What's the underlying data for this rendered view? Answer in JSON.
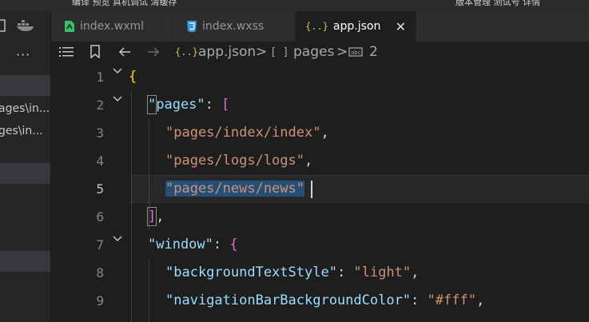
{
  "topbar": {
    "menu_text": "编译   预览   真机调试   清缓存",
    "right_text": "版本管理   测试号   详情"
  },
  "sidebar": {
    "more_label": "···",
    "items": [
      "ages\\in...",
      "ges\\in..."
    ]
  },
  "tabs": [
    {
      "label": "index.wxml",
      "icon": "wxml-file-icon",
      "color": "#3dbb6d"
    },
    {
      "label": "index.wxss",
      "icon": "css-file-icon",
      "color": "#3a96dd"
    },
    {
      "label": "app.json",
      "icon": "json-file-icon",
      "color": "#d7ba5d",
      "active": true,
      "close": "✕"
    }
  ],
  "breadcrumb": {
    "file": "app.json",
    "sep1": ">",
    "pages_label": "pages",
    "sep2": ">",
    "index_label": "2"
  },
  "editor": {
    "current_line": 5,
    "lines": [
      {
        "n": "1",
        "p1": "{"
      },
      {
        "n": "2",
        "key": "\"pages\"",
        "colon": ": ",
        "bracket": "["
      },
      {
        "n": "3",
        "str": "\"pages/index/index\"",
        "comma": ","
      },
      {
        "n": "4",
        "str": "\"pages/logs/logs\"",
        "comma": ","
      },
      {
        "n": "5",
        "str": "\"pages/news/news\""
      },
      {
        "n": "6",
        "bracket": "]",
        "comma": ","
      },
      {
        "n": "7",
        "key": "\"window\"",
        "colon": ": ",
        "brace": "{"
      },
      {
        "n": "8",
        "key": "\"backgroundTextStyle\"",
        "colon": ": ",
        "str": "\"light\"",
        "comma": ","
      },
      {
        "n": "9",
        "key": "\"navigationBarBackgroundColor\"",
        "colon": ": ",
        "str": "\"#fff\"",
        "comma": ","
      }
    ]
  }
}
